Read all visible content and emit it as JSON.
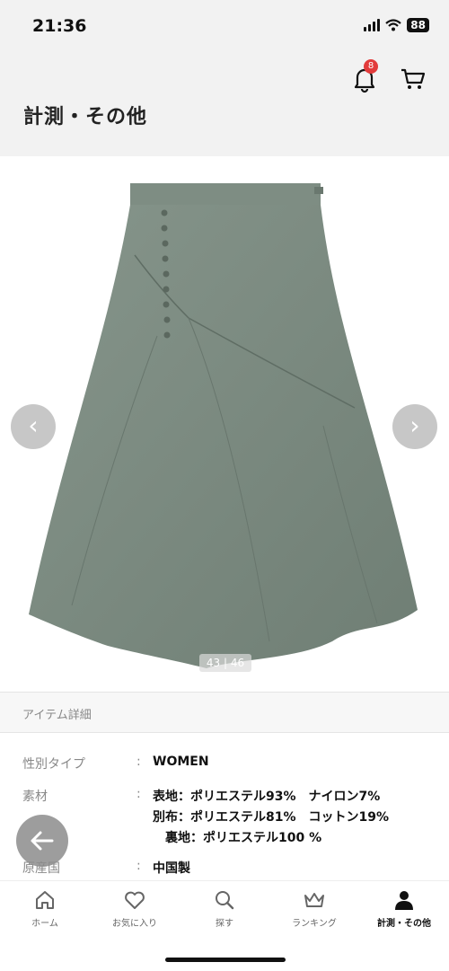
{
  "status_bar": {
    "time": "21:36",
    "battery": "88"
  },
  "header": {
    "title": "計測・その他",
    "notification_count": "8"
  },
  "gallery": {
    "counter": "43 | 46",
    "prev_glyph": "‹",
    "next_glyph": "›"
  },
  "details": {
    "section_title": "アイテム詳細",
    "rows": [
      {
        "label": "性別タイプ",
        "colon": ":",
        "values": [
          "WOMEN"
        ]
      },
      {
        "label": "素材",
        "colon": ":",
        "values": [
          "表地：ポリエステル93%　ナイロン7%",
          "別布：ポリエステル81%　コットン19%",
          "　裏地：ポリエステル100 %"
        ]
      },
      {
        "label": "原産国",
        "colon": ":",
        "values": [
          "中国製"
        ]
      }
    ]
  },
  "tabbar": {
    "items": [
      {
        "label": "ホーム",
        "icon": "home-icon"
      },
      {
        "label": "お気に入り",
        "icon": "heart-icon"
      },
      {
        "label": "探す",
        "icon": "search-icon"
      },
      {
        "label": "ランキング",
        "icon": "crown-icon"
      },
      {
        "label": "計測・その他",
        "icon": "person-icon",
        "active": true
      }
    ]
  },
  "colors": {
    "skirt": "#7b8a80",
    "badge": "#e23b3b",
    "header_bg": "#f2f2f2"
  }
}
